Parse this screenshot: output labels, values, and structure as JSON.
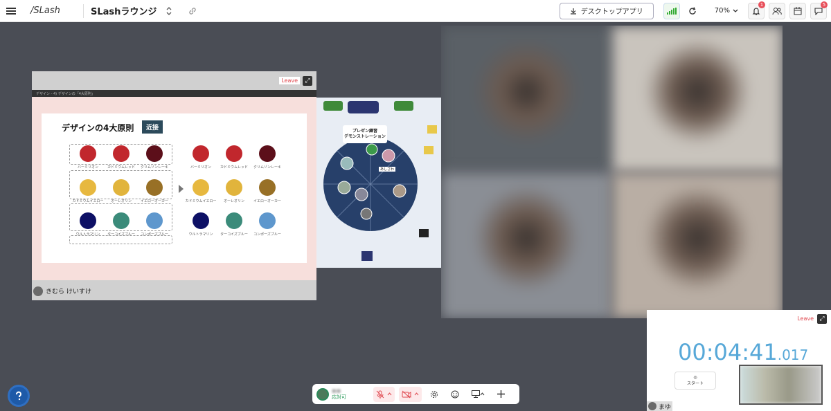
{
  "topbar": {
    "logo_text": "/SLash",
    "room_name": "SLashラウンジ",
    "desktop_app_label": "デスクトップアプリ",
    "zoom_level": "70%",
    "notification_count": "1",
    "chat_count": "5"
  },
  "share_panel": {
    "leave_label": "Leave",
    "browser_tab_text": "デザイン - 4) デザインの「4大原則」",
    "owner_name": "きむら けいすけ",
    "slide": {
      "title": "デザインの4大原則",
      "tag": "近接",
      "colors_left": [
        {
          "name": "バーミリオン",
          "color": "#c1272d"
        },
        {
          "name": "カドミウムレッド",
          "color": "#c1272d"
        },
        {
          "name": "クリムゾンレーキ",
          "color": "#5c0f1a"
        },
        {
          "name": "カドミウムイエロー",
          "color": "#e7b83f"
        },
        {
          "name": "オーレオリン",
          "color": "#e1b43c"
        },
        {
          "name": "イエローオーカー",
          "color": "#987026"
        },
        {
          "name": "ウルトラマリン",
          "color": "#0d1065"
        },
        {
          "name": "ターコイズブルー",
          "color": "#3b8b7a"
        },
        {
          "name": "コンポーズブルー",
          "color": "#5e97cd"
        }
      ],
      "colors_right": [
        {
          "name": "バーミリオン",
          "color": "#c1272d"
        },
        {
          "name": "カドミウムレッド",
          "color": "#c1272d"
        },
        {
          "name": "クリムゾンレーキ",
          "color": "#5c0f1a"
        },
        {
          "name": "カドミウムイエロー",
          "color": "#e7b83f"
        },
        {
          "name": "オーレオリン",
          "color": "#e1b43c"
        },
        {
          "name": "イエローオーカー",
          "color": "#987026"
        },
        {
          "name": "ウルトラマリン",
          "color": "#0d1065"
        },
        {
          "name": "ターコイズブルー",
          "color": "#3b8b7a"
        },
        {
          "name": "コンポーズブルー",
          "color": "#5e97cd"
        }
      ]
    }
  },
  "map": {
    "area_title": "プレゼン練習\nデモンストレーション",
    "user_label": "あしざわ"
  },
  "video_grid": {
    "tile_colors": [
      "#5a6066",
      "#c9c4bd",
      "#8a8e95",
      "#b9aea4"
    ]
  },
  "timer": {
    "leave_label": "Leave",
    "time_main": "00:04:41",
    "time_ms": ".017",
    "start_label": "スタート",
    "owner_name": "まゆ"
  },
  "bottom_bar": {
    "user_status": "応対可",
    "user_name": "■■"
  }
}
